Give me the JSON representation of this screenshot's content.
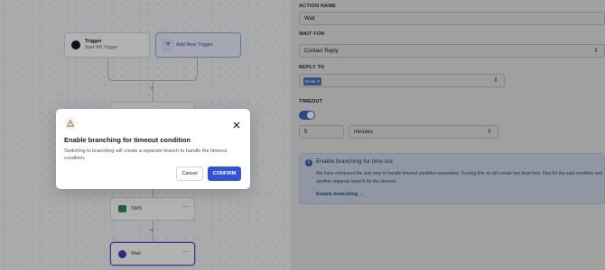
{
  "canvas": {
    "trigger_node": {
      "title": "Trigger",
      "subtitle": "Start Wit Trigger"
    },
    "add_trigger_label": "Add New Trigger",
    "sms_step": {
      "label": "SMS"
    },
    "wait_step": {
      "label": "Wait"
    },
    "more_icon": "⋯",
    "plus_icon": "+"
  },
  "modal": {
    "icon": "warning-icon",
    "title": "Enable branching for timeout condition",
    "description": "Switching to branching will create a separate branch to handle the timeout condition.",
    "cancel_label": "Cancel",
    "confirm_label": "CONFIRM",
    "close_icon": "close-icon"
  },
  "panel": {
    "action_name": {
      "label": "ACTION NAME",
      "value": "Wait"
    },
    "wait_for": {
      "label": "WAIT FOR",
      "value": "Contact Reply"
    },
    "reply_to": {
      "label": "REPLY TO",
      "chip": "Email ✕"
    },
    "timeout": {
      "label": "TIMEOUT",
      "toggle_on": true,
      "amount": "5",
      "unit": "minutes"
    },
    "info": {
      "title": "Enable branching for time out",
      "description": "We have enhanced the wait step to handle timeout condition separately. Turning this on will create two branches. One for the wait condition and another separate branch for the timeout.",
      "link": "Enable branching →"
    }
  },
  "colors": {
    "primary": "#2f55d4",
    "toggle": "#3c6bbf",
    "wait_accent": "#4c3fb5",
    "sms_accent": "#2e8a4e"
  }
}
